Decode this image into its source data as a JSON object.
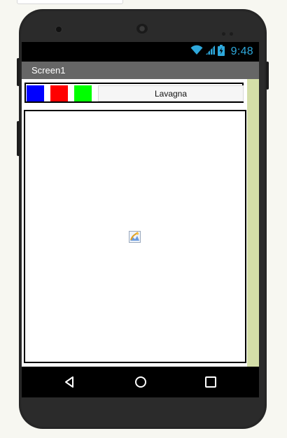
{
  "status_bar": {
    "time": "9:48",
    "icons": [
      "wifi-icon",
      "signal-icon",
      "battery-icon"
    ],
    "accent": "#2ea8db"
  },
  "title_bar": {
    "title": "Screen1",
    "background": "#666666"
  },
  "toolbar": {
    "color_buttons": [
      {
        "name": "blue",
        "color": "#0000ff"
      },
      {
        "name": "red",
        "color": "#ff0000"
      },
      {
        "name": "green",
        "color": "#00ff00"
      }
    ],
    "lavagna_label": "Lavagna"
  },
  "canvas": {
    "icon": "image-placeholder-icon"
  },
  "nav_bar": {
    "buttons": [
      "back-icon",
      "home-icon",
      "recents-icon"
    ]
  }
}
